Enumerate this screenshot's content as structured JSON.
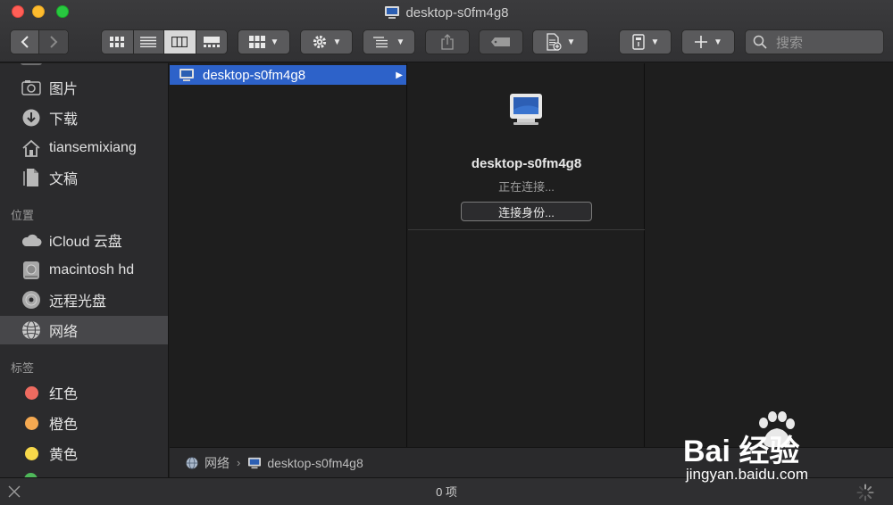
{
  "window": {
    "title": "desktop-s0fm4g8"
  },
  "toolbar": {
    "search_placeholder": "搜索"
  },
  "sidebar": {
    "favorites": [
      {
        "label": "图片",
        "icon": "photos-icon"
      },
      {
        "label": "下载",
        "icon": "download-icon"
      },
      {
        "label": "tiansemixiang",
        "icon": "home-icon"
      },
      {
        "label": "文稿",
        "icon": "documents-icon"
      }
    ],
    "locations_header": "位置",
    "locations": [
      {
        "label": "iCloud 云盘",
        "icon": "icloud-icon"
      },
      {
        "label": "macintosh hd",
        "icon": "harddisk-icon"
      },
      {
        "label": "远程光盘",
        "icon": "disc-icon"
      },
      {
        "label": "网络",
        "icon": "network-icon",
        "selected": true
      }
    ],
    "tags_header": "标签",
    "tags": [
      {
        "label": "红色",
        "color": "#ee6b60"
      },
      {
        "label": "橙色",
        "color": "#f5a951"
      },
      {
        "label": "黄色",
        "color": "#f7d84a"
      }
    ]
  },
  "column1": {
    "selected_item": "desktop-s0fm4g8"
  },
  "preview": {
    "name": "desktop-s0fm4g8",
    "status": "正在连接...",
    "connect_button": "连接身份..."
  },
  "pathbar": {
    "root": "网络",
    "current": "desktop-s0fm4g8"
  },
  "statusbar": {
    "text": "0 项"
  },
  "watermark": {
    "brand": "Bai 经验",
    "url": "jingyan.baidu.com"
  },
  "colors": {
    "selection": "#2d62c9",
    "sidebar_selected": "#47474a"
  }
}
